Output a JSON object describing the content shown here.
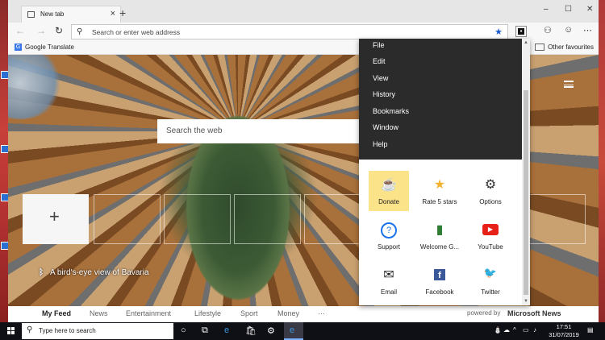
{
  "browser": {
    "tab": {
      "title": "New tab",
      "close": "×"
    },
    "new_tab_button": "+",
    "window_controls": {
      "minimize": "–",
      "maximize": "☐",
      "close": "✕"
    },
    "address_placeholder": "Search or enter web address",
    "favourites": {
      "left_item": "Google Translate",
      "right_item": "Other favourites"
    }
  },
  "page": {
    "search_placeholder": "Search the web",
    "add_tile": "+",
    "image_caption": "A bird's-eye view of Bavaria",
    "feed": [
      {
        "label": "My Feed"
      },
      {
        "label": "News"
      },
      {
        "label": "Entertainment"
      },
      {
        "label": "Lifestyle"
      },
      {
        "label": "Sport"
      },
      {
        "label": "Money"
      },
      {
        "label": "···"
      }
    ],
    "powered_by": "powered by",
    "microsoft_news": "Microsoft News"
  },
  "menu": {
    "items": [
      "File",
      "Edit",
      "View",
      "History",
      "Bookmarks",
      "Window",
      "Help"
    ],
    "grid": [
      {
        "label": "Donate",
        "icon": "coffee-icon",
        "glyph": "☕"
      },
      {
        "label": "Rate 5 stars",
        "icon": "star-icon",
        "glyph": "★"
      },
      {
        "label": "Options",
        "icon": "gear-icon",
        "glyph": "⚙"
      },
      {
        "label": "Support",
        "icon": "question-icon",
        "glyph": "?"
      },
      {
        "label": "Welcome G...",
        "icon": "bookmark-icon",
        "glyph": "▮"
      },
      {
        "label": "YouTube",
        "icon": "youtube-icon",
        "glyph": "▶"
      },
      {
        "label": "Email",
        "icon": "envelope-icon",
        "glyph": "✉"
      },
      {
        "label": "Facebook",
        "icon": "facebook-icon",
        "glyph": "f"
      },
      {
        "label": "Twitter",
        "icon": "twitter-icon",
        "glyph": "🐦"
      }
    ]
  },
  "taskbar": {
    "search_placeholder": "Type here to search",
    "time": "17:51",
    "date": "31/07/2019"
  },
  "colors": {
    "accent": "#1a5dd0",
    "menu_dark": "#2b2b2b",
    "donate_highlight": "#fbe38a",
    "star": "#f3b230",
    "youtube": "#e62117",
    "facebook": "#3b5998",
    "twitter": "#1da1f2",
    "bookmark": "#2e7d32"
  }
}
